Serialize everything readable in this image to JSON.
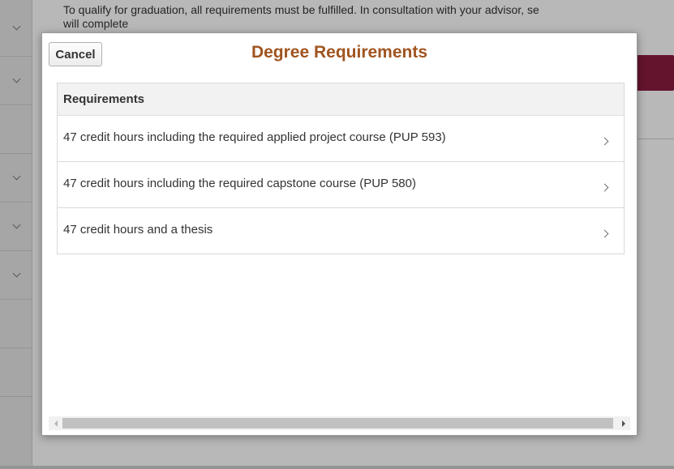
{
  "background": {
    "intro_line1": "To qualify for graduation, all requirements must be fulfilled. In consultation with your advisor, se",
    "intro_line2": "will complete",
    "accent_color": "#8c1d40"
  },
  "modal": {
    "cancel_label": "Cancel",
    "title": "Degree Requirements",
    "title_color": "#a0541f",
    "requirements_header": "Requirements",
    "requirements": [
      {
        "label": "47 credit hours including the required applied project course (PUP 593)"
      },
      {
        "label": "47 credit hours including the required capstone course (PUP 580)"
      },
      {
        "label": "47 credit hours and a thesis"
      }
    ]
  },
  "icons": {
    "row_chevron": "chevron-right-icon",
    "rail_chevron": "chevron-down-icon",
    "scroll_left": "arrow-left-icon",
    "scroll_right": "arrow-right-icon"
  }
}
